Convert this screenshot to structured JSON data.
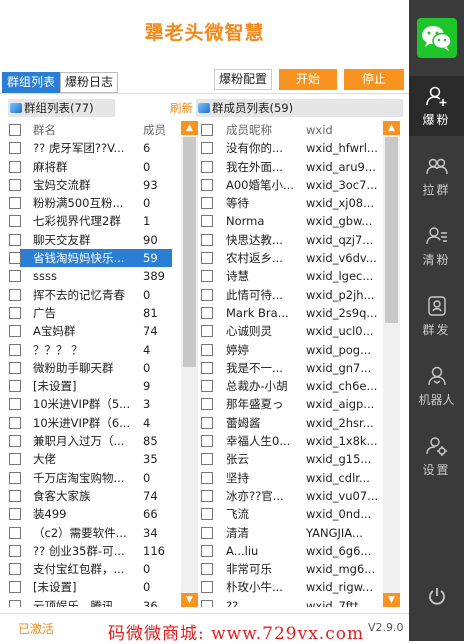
{
  "app": {
    "title": "犟老头微智慧",
    "version": "V2.9.0",
    "status": "已激活",
    "watermark": "码微微商城: www.729vx.com"
  },
  "tabs": [
    {
      "label": "群组列表",
      "active": true
    },
    {
      "label": "爆粉日志",
      "active": false
    }
  ],
  "toolbar": {
    "config_label": "爆粉配置",
    "start_label": "开始",
    "stop_label": "停止",
    "accent": "#f7931e"
  },
  "left_panel": {
    "header": "群组列表(77)",
    "col_name": "群名",
    "col_count": "成员",
    "rows": [
      {
        "name": "?? 虎牙军团??V...",
        "count": "6"
      },
      {
        "name": "麻将群",
        "count": "0"
      },
      {
        "name": "宝妈交流群",
        "count": "93"
      },
      {
        "name": "粉粉满500互粉...",
        "count": "0"
      },
      {
        "name": "七彩视界代理2群",
        "count": "1"
      },
      {
        "name": "聊天交友群",
        "count": "90"
      },
      {
        "name": "省钱淘妈妈快乐...",
        "count": "59",
        "selected": true
      },
      {
        "name": "ssss",
        "count": "389"
      },
      {
        "name": "挥不去的记忆青春",
        "count": "0"
      },
      {
        "name": "广告",
        "count": "81"
      },
      {
        "name": "A宝妈群",
        "count": "74"
      },
      {
        "name": "？？？ ？",
        "count": "4"
      },
      {
        "name": "微粉助手聊天群",
        "count": "0"
      },
      {
        "name": "[未设置]",
        "count": "9"
      },
      {
        "name": "10米进VIP群（5...",
        "count": "3"
      },
      {
        "name": "10米进VIP群（6...",
        "count": "4"
      },
      {
        "name": "兼职月入过万（...",
        "count": "85"
      },
      {
        "name": "大佬",
        "count": "35"
      },
      {
        "name": "千万店淘宝购物...",
        "count": "0"
      },
      {
        "name": "食客大家族",
        "count": "74"
      },
      {
        "name": "装499",
        "count": "66"
      },
      {
        "name": "（c2）需要软件...",
        "count": "34"
      },
      {
        "name": "?? 创业35群-可...",
        "count": "116"
      },
      {
        "name": "支付宝红包群，...",
        "count": "0"
      },
      {
        "name": "[未设置]",
        "count": "0"
      },
      {
        "name": "云顶娱乐，腾讯...",
        "count": "36"
      }
    ]
  },
  "right_panel": {
    "refresh_label": "刷新",
    "header": "群成员列表(59)",
    "col_name": "成员昵称",
    "col_id": "wxid",
    "rows": [
      {
        "name": "没有你的...",
        "id": "wxid_hfwrl..."
      },
      {
        "name": "我在外面...",
        "id": "wxid_aru9..."
      },
      {
        "name": "A00婚笔小...",
        "id": "wxid_3oc7..."
      },
      {
        "name": "等待",
        "id": "wxid_xj08..."
      },
      {
        "name": "Norma",
        "id": "wxid_gbw..."
      },
      {
        "name": "快思达教...",
        "id": "wxid_qzj7..."
      },
      {
        "name": "农村返乡...",
        "id": "wxid_v6dv..."
      },
      {
        "name": "诗慧",
        "id": "wxid_lgec..."
      },
      {
        "name": "此情可待...",
        "id": "wxid_p2jh..."
      },
      {
        "name": "Mark Bra...",
        "id": "wxid_2s9q..."
      },
      {
        "name": "心诚则灵",
        "id": "wxid_ucl0..."
      },
      {
        "name": "婷婷",
        "id": "wxid_pog..."
      },
      {
        "name": "我是不一...",
        "id": "wxid_gn7..."
      },
      {
        "name": "总裁办-小胡",
        "id": "wxid_ch6e..."
      },
      {
        "name": "那年盛夏っ",
        "id": "wxid_aigp..."
      },
      {
        "name": "蕾姆酱",
        "id": "wxid_2hsr..."
      },
      {
        "name": "幸福人生0...",
        "id": "wxid_1x8k..."
      },
      {
        "name": "张云",
        "id": "wxid_g15..."
      },
      {
        "name": "坚持",
        "id": "wxid_cdlr..."
      },
      {
        "name": "冰亦??官...",
        "id": "wxid_vu07..."
      },
      {
        "name": "飞流",
        "id": "wxid_0nd..."
      },
      {
        "name": "清清",
        "id": "YANGJIA..."
      },
      {
        "name": "A...liu",
        "id": "wxid_6g6..."
      },
      {
        "name": "非常可乐",
        "id": "wxid_mg6..."
      },
      {
        "name": "朴玫小牛...",
        "id": "wxid_rigw..."
      },
      {
        "name": "??",
        "id": "wxid_7ftt..."
      }
    ]
  },
  "sidebar": {
    "items": [
      {
        "label": "爆粉",
        "icon": "user-add-icon",
        "active": true
      },
      {
        "label": "拉群",
        "icon": "group-icon",
        "active": false
      },
      {
        "label": "清粉",
        "icon": "user-list-icon",
        "active": false
      },
      {
        "label": "群发",
        "icon": "chat-send-icon",
        "active": false
      },
      {
        "label": "机器人",
        "icon": "robot-user-icon",
        "active": false
      },
      {
        "label": "设置",
        "icon": "user-settings-icon",
        "active": false
      }
    ]
  }
}
